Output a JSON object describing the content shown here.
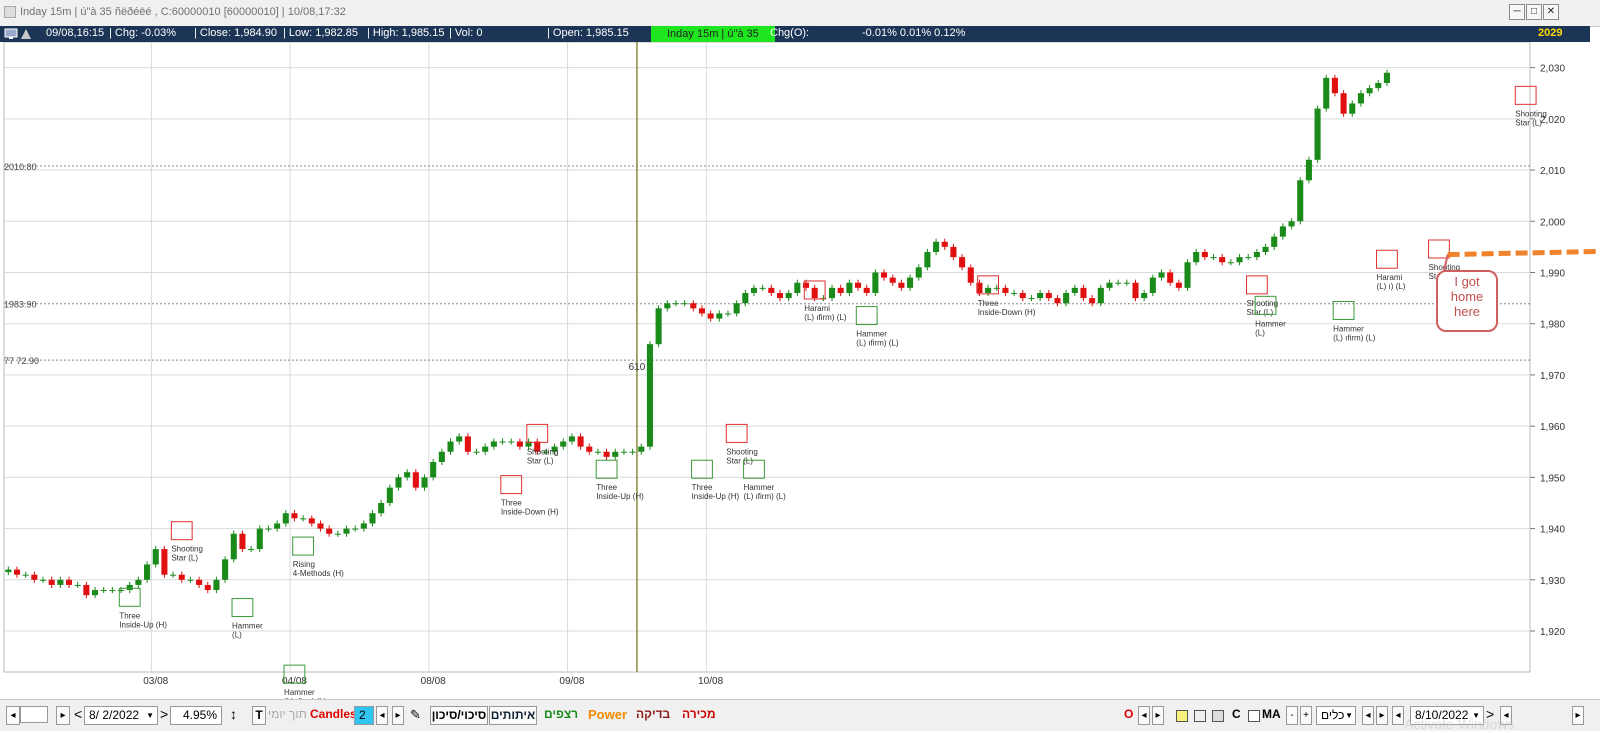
{
  "window": {
    "title": "Inday 15m | ú\"à 35 ñëðéëé , C:60000010 [60000010] | 10/08,17:32",
    "buttons": {
      "minimize": "─",
      "maximize": "□",
      "close": "✕"
    }
  },
  "infobar": {
    "date_time": "09/08,16:15",
    "chg": "| Chg: -0.03%",
    "close": "| Close: 1,984.90",
    "low": "| Low: 1,982.85",
    "high": "| High: 1,985.15",
    "vol": "| Vol: 0",
    "open": "| Open: 1,985.15",
    "symbol_box": "Inday 15m | ú\"à 35",
    "chg_o_label": "Chg(O):",
    "chg_o_values": "-0.01%  0.01%  0.12%",
    "last_price": "2029"
  },
  "chart_data": {
    "type": "candlestick",
    "title": "",
    "ylim": [
      1912,
      2035
    ],
    "y_ticks": [
      "2,030",
      "2,020",
      "2,010",
      "2,000",
      "1,990",
      "1,980",
      "1,970",
      "1,960",
      "1,950",
      "1,940",
      "1,930",
      "1,920"
    ],
    "y_tick_values": [
      2030,
      2020,
      2010,
      2000,
      1990,
      1980,
      1970,
      1960,
      1950,
      1940,
      1930,
      1920
    ],
    "x_labels": [
      "03/08",
      "04/08",
      "08/08",
      "09/08",
      "10/08"
    ],
    "x_label_bars": [
      17,
      33,
      49,
      65,
      81
    ],
    "day_separator_bars": [
      16.5,
      32.5,
      48.5,
      64.5,
      80.5
    ],
    "reference_lines": [
      {
        "label": "2010.80",
        "value": 2010.8
      },
      {
        "label": "1983.90",
        "value": 1983.9
      },
      {
        "label": "77 72.90",
        "value": 1972.9
      }
    ],
    "vertical_marker": {
      "label": "610",
      "bar": 72.5
    },
    "colors": {
      "up": "#1a8a1a",
      "down": "#e01010",
      "grid": "#d9d9d9",
      "marker": "#8a8a3a",
      "pattern_up": "#3a9a3a",
      "pattern_down": "#e03030",
      "projection": "#f0822c"
    },
    "closes": [
      1932,
      1931,
      1931,
      1930,
      1930,
      1929,
      1930,
      1929,
      1929,
      1927,
      1928,
      1928,
      1928,
      1928,
      1929,
      1930,
      1933,
      1936,
      1931,
      1931,
      1930,
      1930,
      1929,
      1928,
      1930,
      1934,
      1939,
      1936,
      1936,
      1940,
      1940,
      1941,
      1943,
      1942,
      1942,
      1941,
      1940,
      1939,
      1939,
      1940,
      1940,
      1941,
      1943,
      1945,
      1948,
      1950,
      1951,
      1948,
      1950,
      1953,
      1955,
      1957,
      1958,
      1955,
      1955,
      1956,
      1957,
      1957,
      1957,
      1956,
      1957,
      1955,
      1955,
      1956,
      1957,
      1958,
      1956,
      1955,
      1955,
      1954,
      1955,
      1955,
      1955,
      1956,
      1976,
      1983,
      1984,
      1984,
      1984,
      1983,
      1982,
      1981,
      1982,
      1982,
      1984,
      1986,
      1987,
      1987,
      1986,
      1985,
      1986,
      1988,
      1987,
      1985,
      1985,
      1987,
      1986,
      1988,
      1987,
      1986,
      1990,
      1989,
      1988,
      1987,
      1989,
      1991,
      1994,
      1996,
      1995,
      1993,
      1991,
      1988,
      1986,
      1987,
      1987,
      1986,
      1986,
      1985,
      1985,
      1986,
      1985,
      1984,
      1986,
      1987,
      1985,
      1984,
      1987,
      1988,
      1988,
      1988,
      1985,
      1986,
      1989,
      1990,
      1988,
      1987,
      1992,
      1994,
      1993,
      1993,
      1992,
      1992,
      1993,
      1993,
      1994,
      1995,
      1997,
      1999,
      2000,
      2008,
      2012,
      2022,
      2028,
      2025,
      2021,
      2023,
      2025,
      2026,
      2027,
      2029
    ],
    "patterns": [
      {
        "label": "Three\nInside-Up (H)",
        "bar": 14,
        "value": 1926,
        "type": "bull"
      },
      {
        "label": "Shooting\nStar (L)",
        "bar": 20,
        "value": 1939,
        "type": "bear"
      },
      {
        "label": "Hammer\n(L)",
        "bar": 27,
        "value": 1924,
        "type": "bull"
      },
      {
        "label": "Rising\n4-Methods (H)",
        "bar": 34,
        "value": 1936,
        "type": "bull"
      },
      {
        "label": "Hammer\n(L)     ıfirm) (L)",
        "bar": 33,
        "value": 1911,
        "type": "bull"
      },
      {
        "label": "Three\nInside-Down (H)",
        "bar": 58,
        "value": 1948,
        "type": "bear"
      },
      {
        "label": "Shooting\nStar (L)",
        "bar": 61,
        "value": 1958,
        "type": "bear"
      },
      {
        "label": "Three\nInside-Up (H)",
        "bar": 69,
        "value": 1951,
        "type": "bull"
      },
      {
        "label": "Three\nInside-Up (H)",
        "bar": 80,
        "value": 1951,
        "type": "bull"
      },
      {
        "label": "Shooting\nStar (L)",
        "bar": 84,
        "value": 1958,
        "type": "bear"
      },
      {
        "label": "Hammer\n(L)       ıfirm) (L)",
        "bar": 86,
        "value": 1951,
        "type": "bull"
      },
      {
        "label": "Harami\n(L)       ıfirm) (L)",
        "bar": 93,
        "value": 1986,
        "type": "bear"
      },
      {
        "label": "Hammer\n(L)       ıfirm) (L)",
        "bar": 99,
        "value": 1981,
        "type": "bull"
      },
      {
        "label": "Three\nInside-Down (H)",
        "bar": 113,
        "value": 1987,
        "type": "bear"
      },
      {
        "label": "Shooting\nStar (L)",
        "bar": 144,
        "value": 1987,
        "type": "bear"
      },
      {
        "label": "Hammer\n(L)",
        "bar": 145,
        "value": 1983,
        "type": "bull"
      },
      {
        "label": "Hammer\n(L)       ıfirm) (L)",
        "bar": 154,
        "value": 1982,
        "type": "bull"
      },
      {
        "label": "Harami\n(L)        ı) (L)",
        "bar": 159,
        "value": 1992,
        "type": "bear"
      },
      {
        "label": "Shooting\nStar (L)",
        "bar": 165,
        "value": 1994,
        "type": "bear"
      },
      {
        "label": "Shooting\nStar (L)",
        "bar": 175,
        "value": 2024,
        "type": "bear"
      }
    ],
    "projection": {
      "from_bar": 166,
      "to_bar": 189,
      "from_value": 1993.5,
      "to_value": 1994.3
    }
  },
  "annotation": {
    "callout_text": "I got home here"
  },
  "bottombar": {
    "nav_first": "<",
    "nav_prev": "◂",
    "nav_next": "▸",
    "nav_last": ">",
    "date_from": "8/  2/2022",
    "percent": "4.95%",
    "t_label": "T",
    "mode_gray": "תוך יומי",
    "candles_label": "Candles",
    "candles_count": "2",
    "tab_risk": "סיכוי/סיכון",
    "tab_signals": "איתותים",
    "tab_continuous": "רצפים",
    "tab_power": "Power",
    "tab_check": "בדיקה",
    "tab_sell": "מכירה",
    "o_label": "O",
    "c_label": "C",
    "ma_label": "MA",
    "minus": "-",
    "plus": "+",
    "all_select": "כלים",
    "date_to": "8/10/2022",
    "watermark": "Activate Windows"
  }
}
